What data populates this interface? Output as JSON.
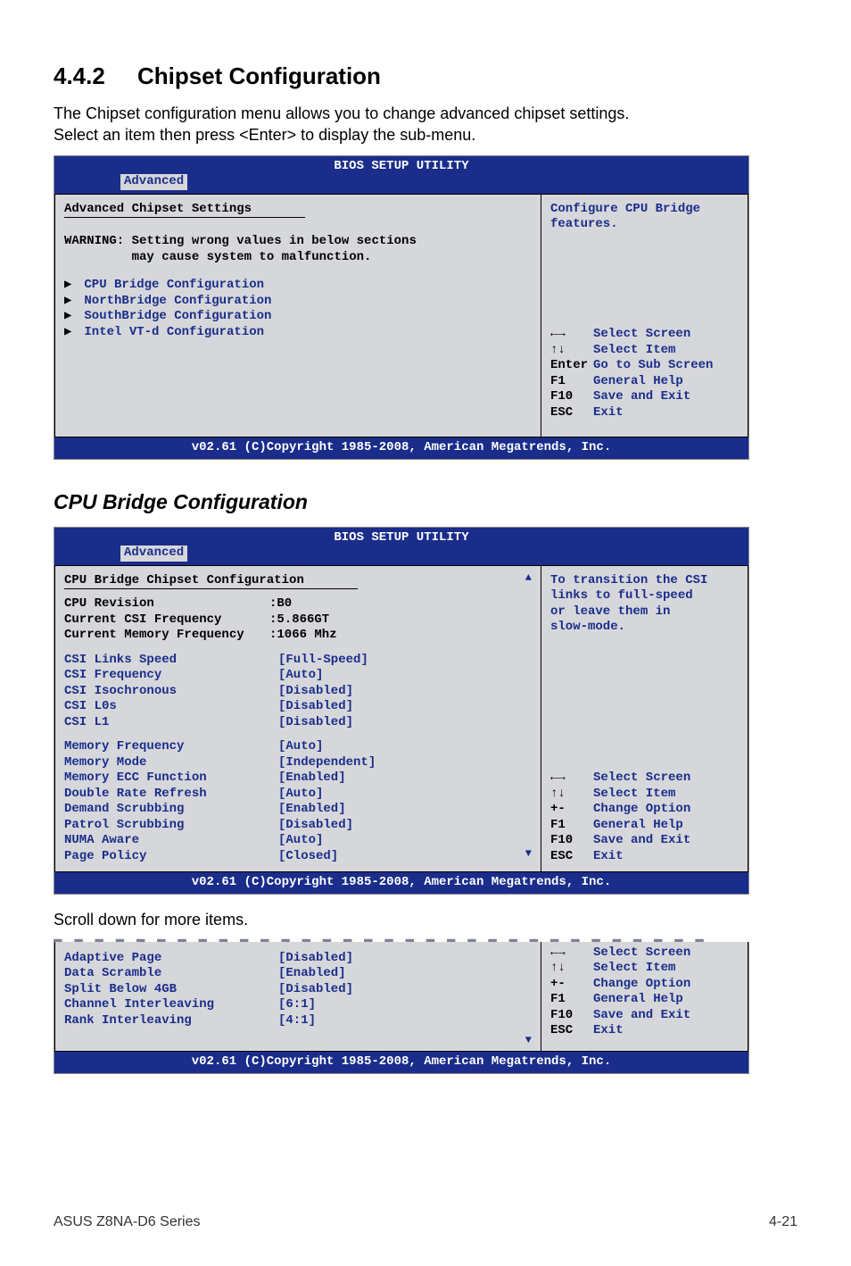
{
  "heading_number": "4.4.2",
  "heading_title": "Chipset Configuration",
  "intro_line1": "The Chipset configuration menu allows you to change advanced chipset settings.",
  "intro_line2": "Select an item then press <Enter> to display the sub-menu.",
  "bios_title": "BIOS SETUP UTILITY",
  "tab_label": "Advanced",
  "bios1": {
    "heading": "Advanced Chipset Settings",
    "warning_l1": "WARNING: Setting wrong values in below sections",
    "warning_l2": "         may cause system to malfunction.",
    "items": [
      "CPU Bridge Configuration",
      "NorthBridge Configuration",
      "SouthBridge Configuration",
      "Intel VT-d Configuration"
    ],
    "help_title_l1": "Configure CPU Bridge",
    "help_title_l2": "features.",
    "help": [
      {
        "key": "←→",
        "act": "Select Screen"
      },
      {
        "key": "↑↓",
        "act": "Select Item"
      },
      {
        "key": "Enter",
        "act": "Go to Sub Screen"
      },
      {
        "key": "F1",
        "act": "General Help"
      },
      {
        "key": "F10",
        "act": "Save and Exit"
      },
      {
        "key": "ESC",
        "act": "Exit"
      }
    ]
  },
  "sub_heading": "CPU Bridge Configuration",
  "bios2": {
    "heading": "CPU Bridge Chipset Configuration",
    "info": [
      {
        "label": "CPU Revision",
        "val": ":B0"
      },
      {
        "label": "Current CSI Frequency",
        "val": ":5.866GT"
      },
      {
        "label": "Current Memory Frequency",
        "val": ":1066 Mhz"
      }
    ],
    "opts1": [
      {
        "label": "CSI Links Speed",
        "val": "[Full-Speed]"
      },
      {
        "label": "CSI Frequency",
        "val": "[Auto]"
      },
      {
        "label": "CSI Isochronous",
        "val": "[Disabled]"
      },
      {
        "label": "CSI L0s",
        "val": "[Disabled]"
      },
      {
        "label": "CSI L1",
        "val": "[Disabled]"
      }
    ],
    "opts2": [
      {
        "label": "Memory Frequency",
        "val": "[Auto]"
      },
      {
        "label": "Memory Mode",
        "val": "[Independent]"
      },
      {
        "label": "Memory ECC Function",
        "val": "[Enabled]"
      },
      {
        "label": "Double Rate Refresh",
        "val": "[Auto]"
      },
      {
        "label": "Demand Scrubbing",
        "val": "[Enabled]"
      },
      {
        "label": "Patrol Scrubbing",
        "val": "[Disabled]"
      },
      {
        "label": "NUMA Aware",
        "val": "[Auto]"
      },
      {
        "label": "Page Policy",
        "val": "[Closed]"
      }
    ],
    "help_title_l1": "To transition the CSI",
    "help_title_l2": "links to full-speed",
    "help_title_l3": "or leave them in",
    "help_title_l4": "slow-mode.",
    "help": [
      {
        "key": "←→",
        "act": "Select Screen"
      },
      {
        "key": "↑↓",
        "act": "Select Item"
      },
      {
        "key": "+-",
        "act": "Change Option"
      },
      {
        "key": "F1",
        "act": "General Help"
      },
      {
        "key": "F10",
        "act": "Save and Exit"
      },
      {
        "key": "ESC",
        "act": "Exit"
      }
    ]
  },
  "scroll_caption": "Scroll down for more items.",
  "bios3": {
    "opts": [
      {
        "label": "Adaptive Page",
        "val": "[Disabled]"
      },
      {
        "label": "Data Scramble",
        "val": "[Enabled]"
      },
      {
        "label": "Split Below 4GB",
        "val": "[Disabled]"
      },
      {
        "label": "Channel Interleaving",
        "val": "[6:1]"
      },
      {
        "label": "Rank Interleaving",
        "val": "[4:1]"
      }
    ],
    "help": [
      {
        "key": "←→",
        "act": "Select Screen"
      },
      {
        "key": "↑↓",
        "act": "Select Item"
      },
      {
        "key": "+-",
        "act": "Change Option"
      },
      {
        "key": "F1",
        "act": "General Help"
      },
      {
        "key": "F10",
        "act": "Save and Exit"
      },
      {
        "key": "ESC",
        "act": "Exit"
      }
    ]
  },
  "copyright": "v02.61 (C)Copyright 1985-2008, American Megatrends, Inc.",
  "footer_left": "ASUS Z8NA-D6 Series",
  "footer_right": "4-21"
}
